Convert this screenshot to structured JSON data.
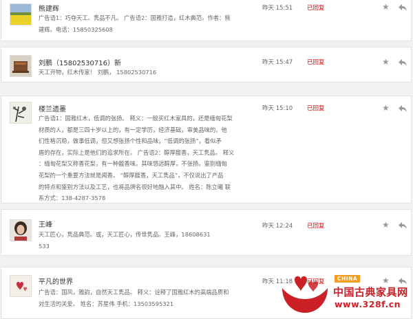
{
  "messages": [
    {
      "name": "熊建辉",
      "avatar_icon": "yellow-field-avatar",
      "lines": [
        "广告语1：巧夺天工、隽品不凡。 广告语2：国雅打造，红木典范。作者：熊",
        "建辉。电话：15850325608"
      ],
      "time": "昨天 15:51",
      "status": "已回复"
    },
    {
      "name": "刘鹏（15802530716）新",
      "avatar_icon": "furniture-avatar",
      "lines": [
        "天工开物，红木传家！ 刘鹏， 15802530716"
      ],
      "time": "昨天 15:47",
      "status": "已回复"
    },
    {
      "name": "楼兰遗墨",
      "avatar_icon": "ink-plant-avatar",
      "lines": [
        "广告语1：国雅红木，低调的张扬。 释义：一般买红木家具的，还是缅甸花梨",
        "材质的人，都是三四十岁以上的，有一定学历，经济基础，审美品味的。他",
        "们性格沉稳，做事低调，但又想张扬个性和品味，“低调的张扬”，看似矛",
        "盾的存在，实际上是他们的追求所在。 广告语2：醇厚馥香，天工隽品。 释义",
        "：缅甸花梨又称香花梨，有一种馥香味。其味悠远醇厚，不张扬。鉴别缅甸",
        "花梨的一个重要方法就是闻香。 “醇厚馥香，天工隽品”，不仅说出了产品",
        "的特点和鉴别方法以及工艺，也将品牌名很好地融入其中。 姓名：陈立曦 联",
        "系方式：138-4287-3578"
      ],
      "time": "昨天 15:10",
      "status": "已回复"
    },
    {
      "name": "王峰",
      "avatar_icon": "woman-portrait-avatar",
      "lines": [
        "天工匠心，隽品典范。或，天工匠心，传世隽品。王峰，18608631",
        "533"
      ],
      "time": "昨天 12:24",
      "status": "已回复"
    },
    {
      "name": "平凡的世界",
      "avatar_icon": "hearts-avatar",
      "lines": [
        "广告语：国风，雅韵，自然天工隽品。 释义：诠释了国雅红木的高端品质和",
        "对生活的关爱。 姓名：苏星伟 手机：13503595321"
      ],
      "time": "昨天 11:18",
      "status": "已回复"
    }
  ],
  "icons": {
    "star": "star-icon",
    "reply": "reply-arrow-icon"
  },
  "colors": {
    "status": "#dd0000",
    "brand_red": "#cc2027",
    "badge_orange": "#f39c1d"
  },
  "watermark": {
    "badge": "CHINA",
    "title": "中国古典家具网",
    "url": "www.328f.cn"
  }
}
